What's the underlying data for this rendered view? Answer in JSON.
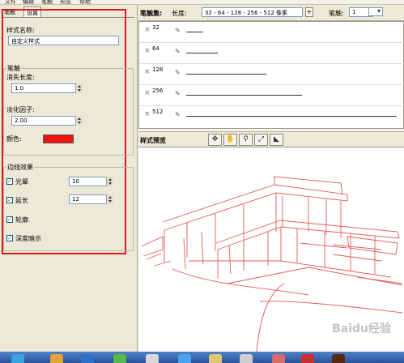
{
  "menu": [
    "文件",
    "编辑",
    "笔触",
    "预览",
    "帮助"
  ],
  "left_panel": {
    "tabs": [
      "笔触",
      "设置"
    ],
    "style_name_label": "样式名称:",
    "style_name_value": "自定义样式",
    "stroke_group_label": "笔触",
    "fade_length_label": "消失长度:",
    "fade_length_value": "1.0",
    "fade_factor_label": "淡化因子:",
    "fade_factor_value": "2.00",
    "color_label": "颜色:",
    "color_value": "#ee1111",
    "edge_group_label": "边线效果",
    "halo_label": "光晕",
    "halo_value": "10",
    "extension_label": "延长",
    "extension_value": "12",
    "profile_label": "轮廓",
    "depth_cue_label": "深度暗示"
  },
  "stroke_set": {
    "title": "笔触集:",
    "length_label": "长度:",
    "length_value": "32 - 64 - 128 - 256 - 512 像素",
    "add_label": "+",
    "stroke_label": "笔触:",
    "stroke_value": "1",
    "rows": [
      "32",
      "64",
      "128",
      "256",
      "512"
    ],
    "row_fill": [
      0.08,
      0.15,
      0.38,
      0.55,
      1.0
    ]
  },
  "preview": {
    "title": "样式预览",
    "tools": [
      "orbit-icon",
      "pan-icon",
      "zoom-icon",
      "zoom-extents-icon",
      "camera-icon"
    ],
    "stroke_color": "#e35b5b"
  },
  "watermark_text": "Baidu经验"
}
